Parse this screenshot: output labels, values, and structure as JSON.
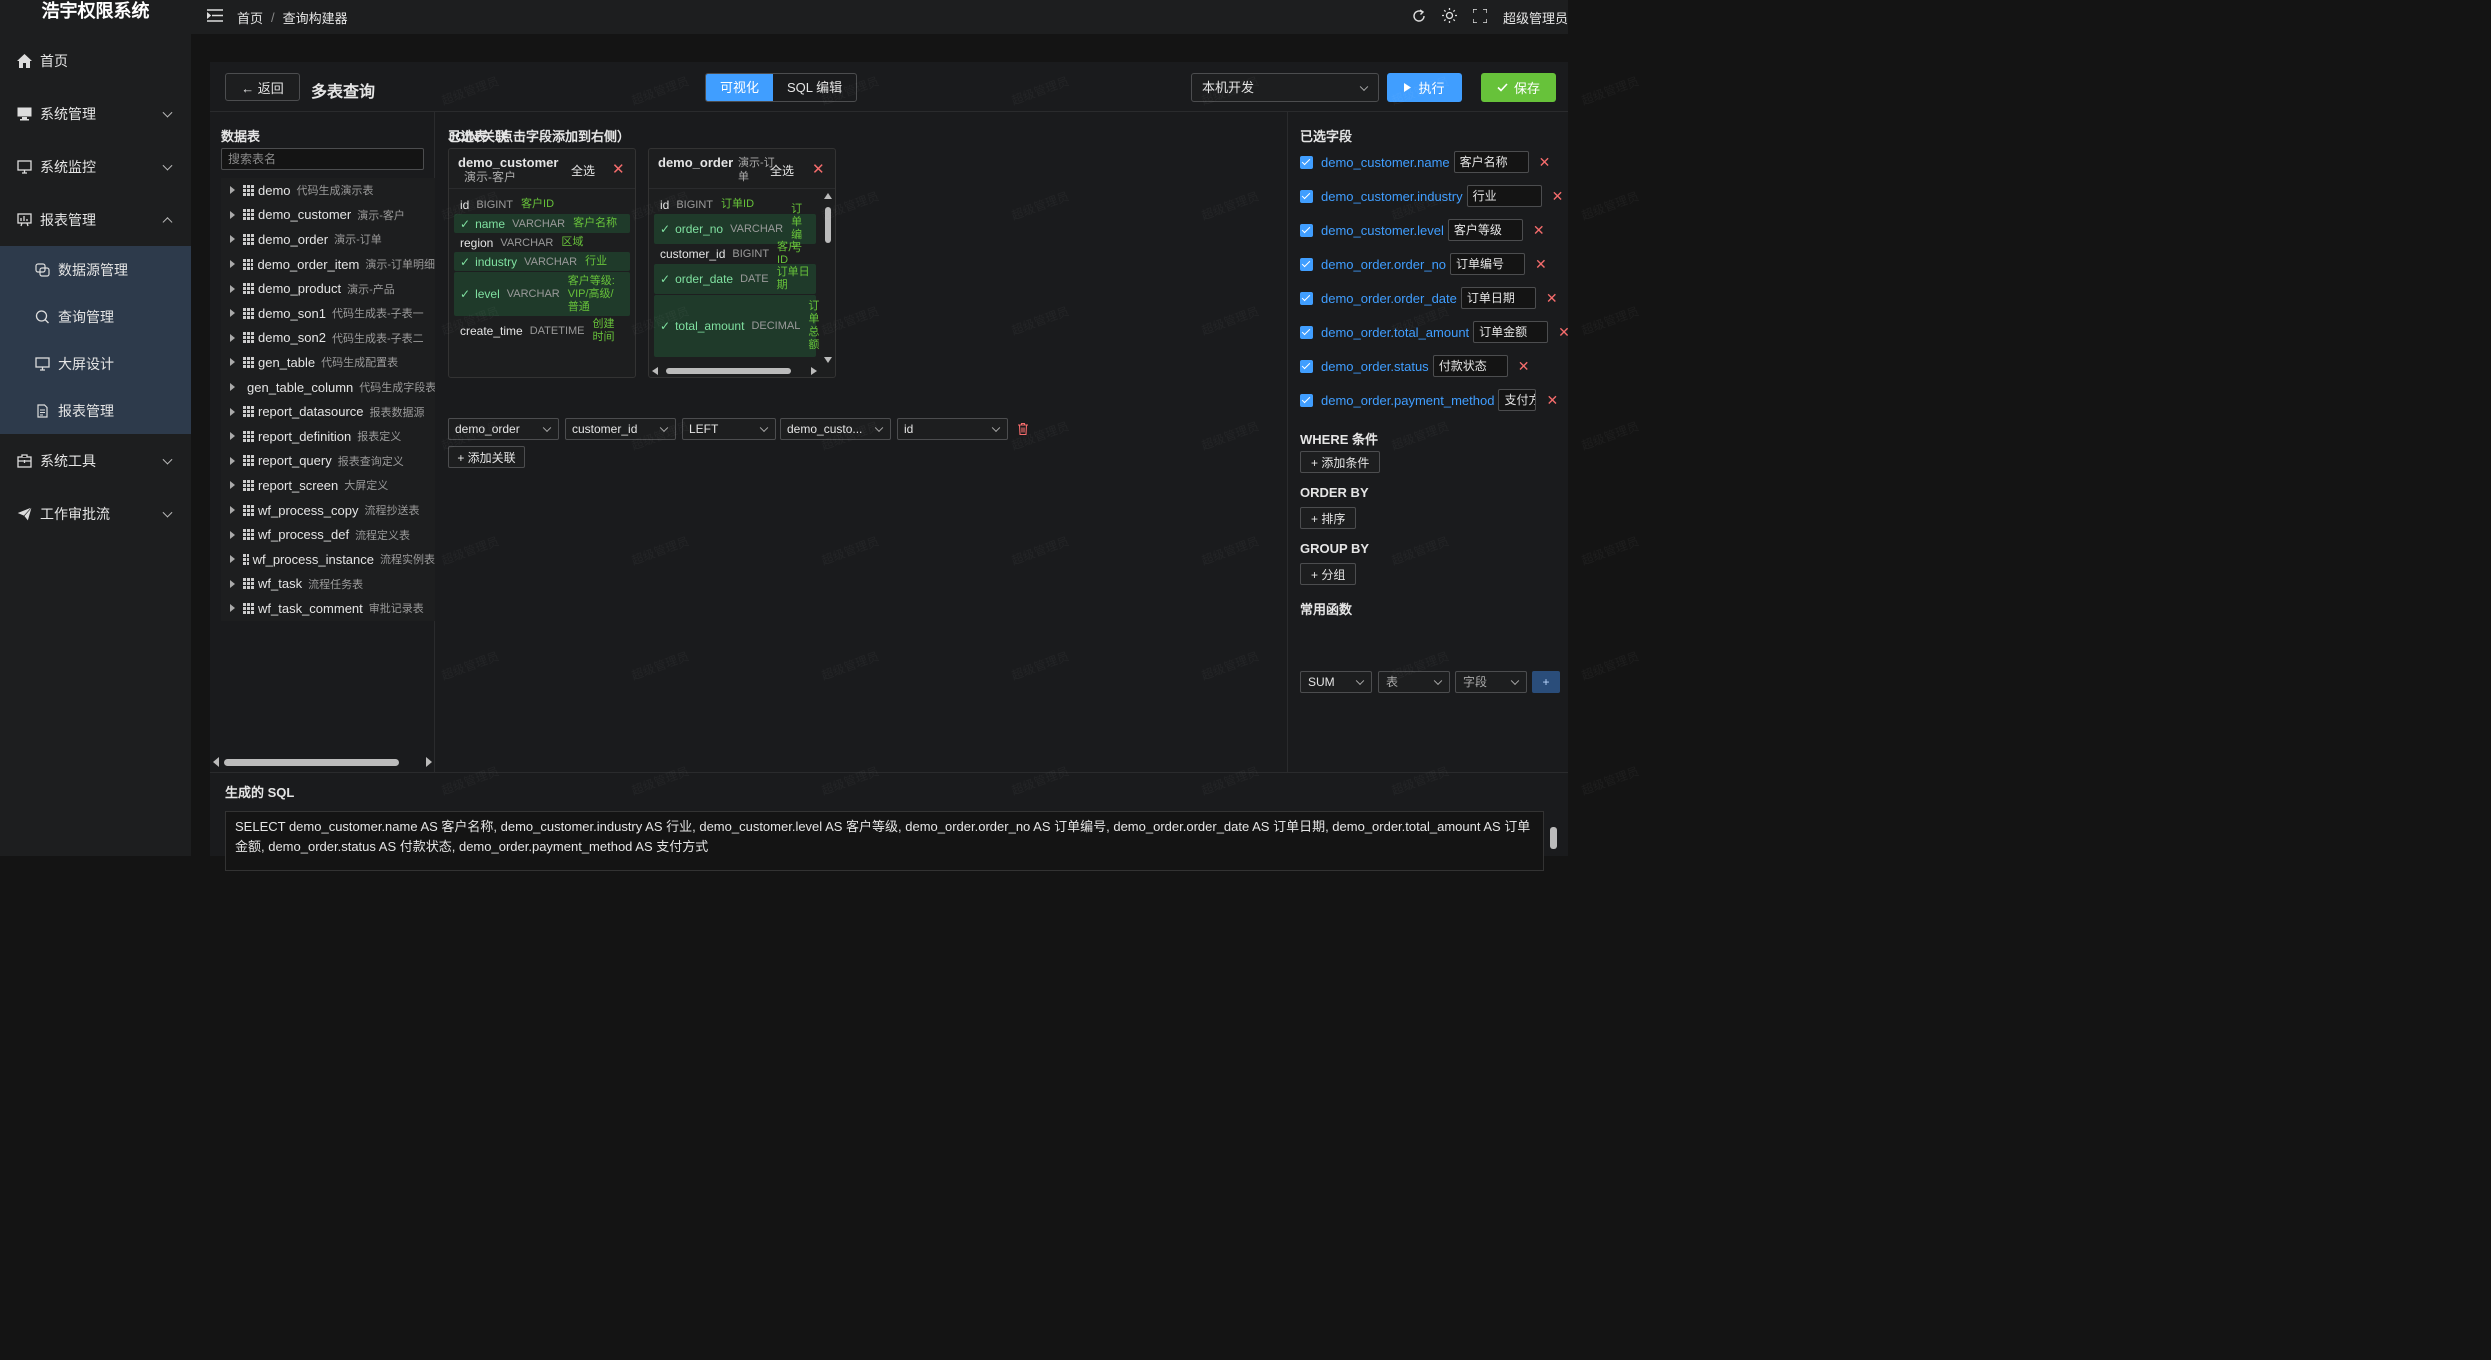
{
  "app": {
    "title": "浩宇权限系统",
    "user": "超级管理员"
  },
  "sidebar": {
    "items": [
      {
        "label": "首页",
        "icon": "home-icon",
        "expandable": false
      },
      {
        "label": "系统管理",
        "icon": "monitor-icon",
        "expandable": true
      },
      {
        "label": "系统监控",
        "icon": "screen-icon",
        "expandable": true
      },
      {
        "label": "报表管理",
        "icon": "report-icon",
        "expandable": true,
        "open": true,
        "children": [
          {
            "label": "数据源管理",
            "icon": "datasource-icon"
          },
          {
            "label": "查询管理",
            "icon": "search-icon"
          },
          {
            "label": "大屏设计",
            "icon": "screen-icon"
          },
          {
            "label": "报表管理",
            "icon": "document-icon"
          }
        ]
      },
      {
        "label": "系统工具",
        "icon": "toolbox-icon",
        "expandable": true
      },
      {
        "label": "工作审批流",
        "icon": "send-icon",
        "expandable": true
      }
    ]
  },
  "breadcrumb": [
    "首页",
    "查询构建器"
  ],
  "header": {
    "back_label": "← 返回",
    "title": "多表查询",
    "mode_visual": "可视化",
    "mode_sql": "SQL 编辑",
    "env": "本机开发",
    "run_label": "执行",
    "save_label": "保存"
  },
  "left": {
    "title": "数据表",
    "search_placeholder": "搜索表名",
    "tables": [
      {
        "name": "demo",
        "comment": "代码生成演示表"
      },
      {
        "name": "demo_customer",
        "comment": "演示-客户"
      },
      {
        "name": "demo_order",
        "comment": "演示-订单"
      },
      {
        "name": "demo_order_item",
        "comment": "演示-订单明细"
      },
      {
        "name": "demo_product",
        "comment": "演示-产品"
      },
      {
        "name": "demo_son1",
        "comment": "代码生成表-子表一"
      },
      {
        "name": "demo_son2",
        "comment": "代码生成表-子表二"
      },
      {
        "name": "gen_table",
        "comment": "代码生成配置表"
      },
      {
        "name": "gen_table_column",
        "comment": "代码生成字段表"
      },
      {
        "name": "report_datasource",
        "comment": "报表数据源"
      },
      {
        "name": "report_definition",
        "comment": "报表定义"
      },
      {
        "name": "report_query",
        "comment": "报表查询定义"
      },
      {
        "name": "report_screen",
        "comment": "大屏定义"
      },
      {
        "name": "wf_process_copy",
        "comment": "流程抄送表"
      },
      {
        "name": "wf_process_def",
        "comment": "流程定义表"
      },
      {
        "name": "wf_process_instance",
        "comment": "流程实例表"
      },
      {
        "name": "wf_task",
        "comment": "流程任务表"
      },
      {
        "name": "wf_task_comment",
        "comment": "审批记录表"
      }
    ]
  },
  "middle": {
    "title": "已选表（点击字段添加到右侧）",
    "select_all": "全选",
    "cards": [
      {
        "name": "demo_customer",
        "comment": "演示-客户",
        "fields": [
          {
            "name": "id",
            "type": "BIGINT",
            "comment": "客户ID",
            "selected": false
          },
          {
            "name": "name",
            "type": "VARCHAR",
            "comment": "客户名称",
            "selected": true
          },
          {
            "name": "region",
            "type": "VARCHAR",
            "comment": "区域",
            "selected": false
          },
          {
            "name": "industry",
            "type": "VARCHAR",
            "comment": "行业",
            "selected": true
          },
          {
            "name": "level",
            "type": "VARCHAR",
            "comment": "客户等级: VIP/高级/普通",
            "selected": true
          },
          {
            "name": "create_time",
            "type": "DATETIME",
            "comment": "创建时间",
            "selected": false
          }
        ]
      },
      {
        "name": "demo_order",
        "comment": "演示-订单",
        "fields": [
          {
            "name": "id",
            "type": "BIGINT",
            "comment": "订单ID",
            "selected": false
          },
          {
            "name": "order_no",
            "type": "VARCHAR",
            "comment": "订单编号",
            "selected": true
          },
          {
            "name": "customer_id",
            "type": "BIGINT",
            "comment": "客户ID",
            "selected": false
          },
          {
            "name": "order_date",
            "type": "DATE",
            "comment": "订单日期",
            "selected": true
          },
          {
            "name": "total_amount",
            "type": "DECIMAL",
            "comment": "订单总额",
            "selected": true
          }
        ]
      }
    ],
    "join_title": "JOIN 关联",
    "join": {
      "left_table": "demo_order",
      "left_field": "customer_id",
      "type": "LEFT",
      "right_table": "demo_custo...",
      "right_field": "id"
    },
    "add_join_label": "+ 添加关联"
  },
  "right": {
    "title": "已选字段",
    "fields": [
      {
        "name": "demo_customer.name",
        "alias": "客户名称"
      },
      {
        "name": "demo_customer.industry",
        "alias": "行业"
      },
      {
        "name": "demo_customer.level",
        "alias": "客户等级"
      },
      {
        "name": "demo_order.order_no",
        "alias": "订单编号"
      },
      {
        "name": "demo_order.order_date",
        "alias": "订单日期"
      },
      {
        "name": "demo_order.total_amount",
        "alias": "订单金额"
      },
      {
        "name": "demo_order.status",
        "alias": "付款状态"
      },
      {
        "name": "demo_order.payment_method",
        "alias": "支付方式"
      }
    ],
    "where_title": "WHERE 条件",
    "add_condition": "+ 添加条件",
    "orderby_title": "ORDER BY",
    "add_sort": "+ 排序",
    "groupby_title": "GROUP BY",
    "add_group": "+ 分组",
    "func_title": "常用函数",
    "func_name": "SUM",
    "func_table_placeholder": "表",
    "func_field_placeholder": "字段",
    "func_add": "+"
  },
  "sql": {
    "title": "生成的 SQL",
    "text": "SELECT demo_customer.name AS 客户名称, demo_customer.industry AS 行业, demo_customer.level AS 客户等级, demo_order.order_no AS 订单编号, demo_order.order_date AS 订单日期, demo_order.total_amount AS 订单金额, demo_order.status AS 付款状态, demo_order.payment_method AS 支付方式"
  },
  "watermark": "超级管理员"
}
